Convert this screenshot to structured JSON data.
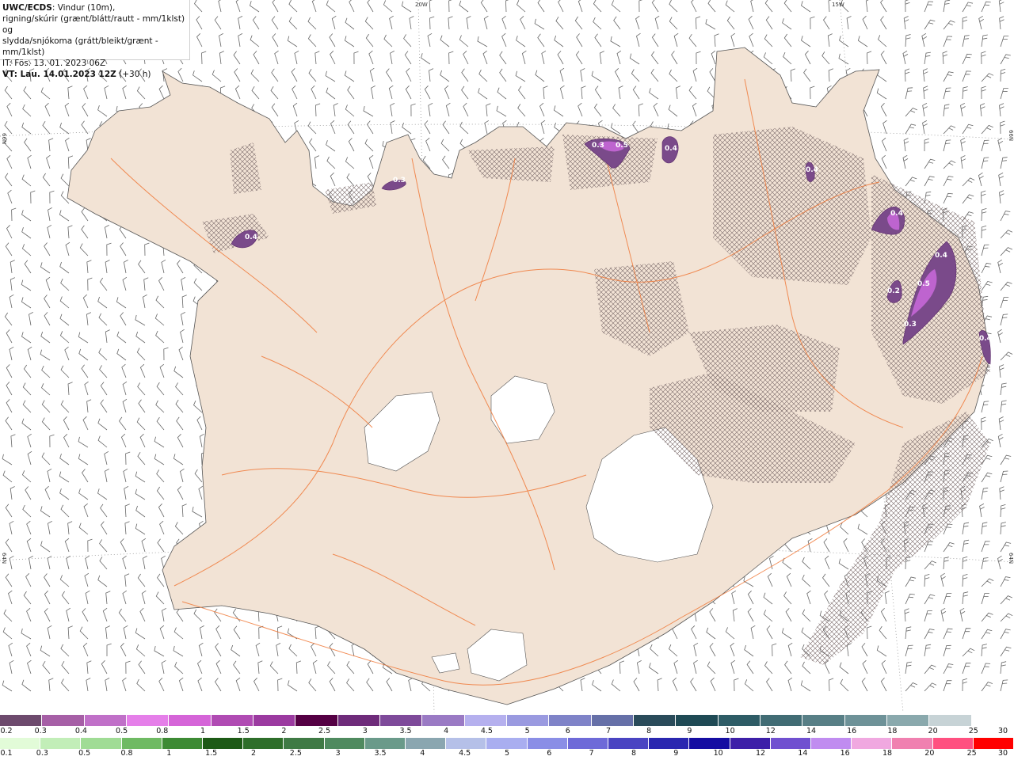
{
  "header": {
    "title_bold": "UWC/ECDS",
    "title_rest": ": Vindur (10m),",
    "line2": "rigning/skúrir (grænt/blátt/rautt - mm/1klst) og",
    "line3": "slydda/snjókoma (grátt/bleikt/grænt - mm/1klst)",
    "it": "IT: Fös. 13. 01. 2023 06Z",
    "vt_bold": "VT: Lau. 14.01.2023 12Z",
    "vt_rest": " (+30 h)"
  },
  "grid_labels": {
    "lon20": "20W",
    "lon15": "15W",
    "lat66_left": "66N",
    "lat66_right": "66N",
    "lat64_left": "64N",
    "lat64_right": "64N"
  },
  "precip_labels": [
    "0.4",
    "0.3",
    "0.3",
    "0.5",
    "0.4",
    "0.4",
    "0.4",
    "0.4",
    "0.5",
    "0.2",
    "0.3",
    "0.4"
  ],
  "snow_scale": {
    "colors": [
      "#6d4a6d",
      "#a65fa6",
      "#c070c8",
      "#e57fe9",
      "#d565d8",
      "#b04bb3",
      "#9b3aa0",
      "#550044",
      "#6e2b7a",
      "#7e4a9a",
      "#9a7ac4",
      "#b5b0ee",
      "#9a9ae0",
      "#7f83c8",
      "#6670a8",
      "#2a4b5a",
      "#1f4a55",
      "#2e5c66",
      "#416c74",
      "#587f86",
      "#6e9298",
      "#8aa9ad",
      "#c7d3d6",
      "#ffffff"
    ],
    "ticks": [
      "0.2",
      "0.3",
      "0.4",
      "0.5",
      "0.8",
      "1",
      "1.5",
      "2",
      "2.5",
      "3",
      "3.5",
      "4",
      "4.5",
      "5",
      "6",
      "7",
      "8",
      "9",
      "10",
      "12",
      "14",
      "16",
      "18",
      "20",
      "25",
      "30"
    ]
  },
  "rain_scale": {
    "colors": [
      "#e2fbd8",
      "#c2eeb8",
      "#a0dc95",
      "#6fba63",
      "#3d8a34",
      "#1d5a16",
      "#2e6e2a",
      "#3f7a45",
      "#4f8a5f",
      "#6a9a8a",
      "#8aa6b0",
      "#b5c0e8",
      "#a9aef0",
      "#8a8ee6",
      "#6e6ad8",
      "#4a44c2",
      "#2a27b0",
      "#150da2",
      "#3d1fa8",
      "#7050d0",
      "#c08cf0",
      "#f0a8e0",
      "#f080b0",
      "#ff5080",
      "#ff0000"
    ],
    "ticks": [
      "0.1",
      "0.3",
      "0.5",
      "0.8",
      "1",
      "1.5",
      "2",
      "2.5",
      "3",
      "3.5",
      "4",
      "4.5",
      "5",
      "6",
      "7",
      "8",
      "9",
      "10",
      "12",
      "14",
      "16",
      "18",
      "20",
      "25",
      "30"
    ]
  }
}
